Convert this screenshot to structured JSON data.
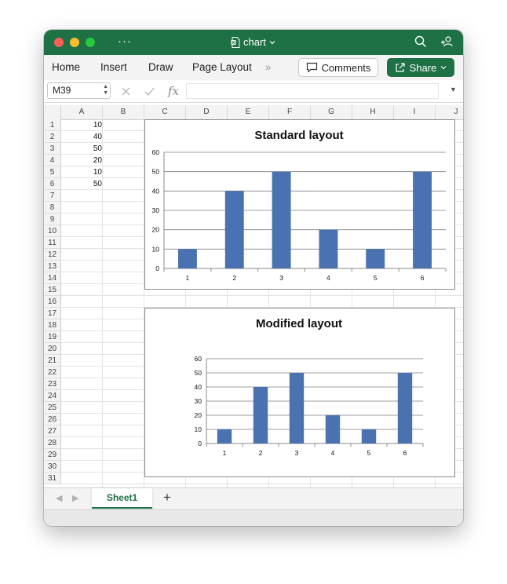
{
  "window": {
    "title": "chart",
    "more_label": "···"
  },
  "ribbon": {
    "tabs": [
      "Home",
      "Insert",
      "Draw",
      "Page Layout"
    ],
    "overflow_label": "»",
    "comments_label": "Comments",
    "share_label": "Share"
  },
  "formula_bar": {
    "name_box": "M39",
    "fx_label": "fx",
    "formula": ""
  },
  "sheet": {
    "columns": [
      "A",
      "B",
      "C",
      "D",
      "E",
      "F",
      "G",
      "H",
      "I",
      "J"
    ],
    "rows": [
      "1",
      "2",
      "3",
      "4",
      "5",
      "6",
      "7",
      "8",
      "9",
      "10",
      "11",
      "12",
      "13",
      "14",
      "15",
      "16",
      "17",
      "18",
      "19",
      "20",
      "21",
      "22",
      "23",
      "24",
      "25",
      "26",
      "27",
      "28",
      "29",
      "30",
      "31"
    ],
    "column_a_values": [
      "10",
      "40",
      "50",
      "20",
      "10",
      "50"
    ]
  },
  "sheet_tabs": {
    "active": "Sheet1",
    "add_label": "+"
  },
  "colors": {
    "brand_green": "#1e7145",
    "bar_fill": "#4a72b0"
  },
  "icons": [
    "excel-doc-icon",
    "search-icon",
    "share-people-icon",
    "comment-icon",
    "share-icon",
    "cancel-x-icon",
    "check-icon",
    "fx-icon"
  ],
  "chart_data": [
    {
      "type": "bar",
      "title": "Standard layout",
      "categories": [
        "1",
        "2",
        "3",
        "4",
        "5",
        "6"
      ],
      "values": [
        10,
        40,
        50,
        20,
        10,
        50
      ],
      "ylim": [
        0,
        60
      ],
      "yticks": [
        "0",
        "10",
        "20",
        "30",
        "40",
        "50",
        "60"
      ],
      "grid": true,
      "legend": "none"
    },
    {
      "type": "bar",
      "title": "Modified layout",
      "categories": [
        "1",
        "2",
        "3",
        "4",
        "5",
        "6"
      ],
      "values": [
        10,
        40,
        50,
        20,
        10,
        50
      ],
      "ylim": [
        0,
        60
      ],
      "yticks": [
        "0",
        "10",
        "20",
        "30",
        "40",
        "50",
        "60"
      ],
      "grid": true,
      "legend": "none"
    }
  ]
}
